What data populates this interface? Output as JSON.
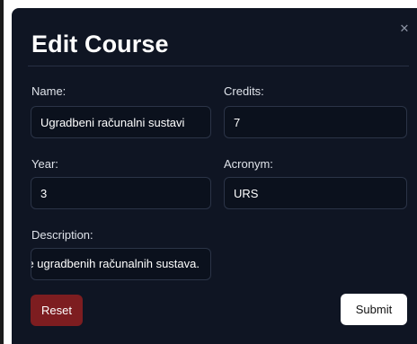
{
  "dialog": {
    "title": "Edit Course",
    "close_icon": "close-icon"
  },
  "form": {
    "name": {
      "label": "Name:",
      "value": "Ugradbeni računalni sustavi"
    },
    "credits": {
      "label": "Credits:",
      "value": "7"
    },
    "year": {
      "label": "Year:",
      "value": "3"
    },
    "acronym": {
      "label": "Acronym:",
      "value": "URS"
    },
    "description": {
      "label": "Description:",
      "value": "e ugradbenih računalnih sustava."
    }
  },
  "actions": {
    "reset_label": "Reset",
    "submit_label": "Submit"
  },
  "colors": {
    "modal_background": "#0f1523",
    "reset_button": "#7d1d20",
    "submit_button": "#ffffff"
  }
}
